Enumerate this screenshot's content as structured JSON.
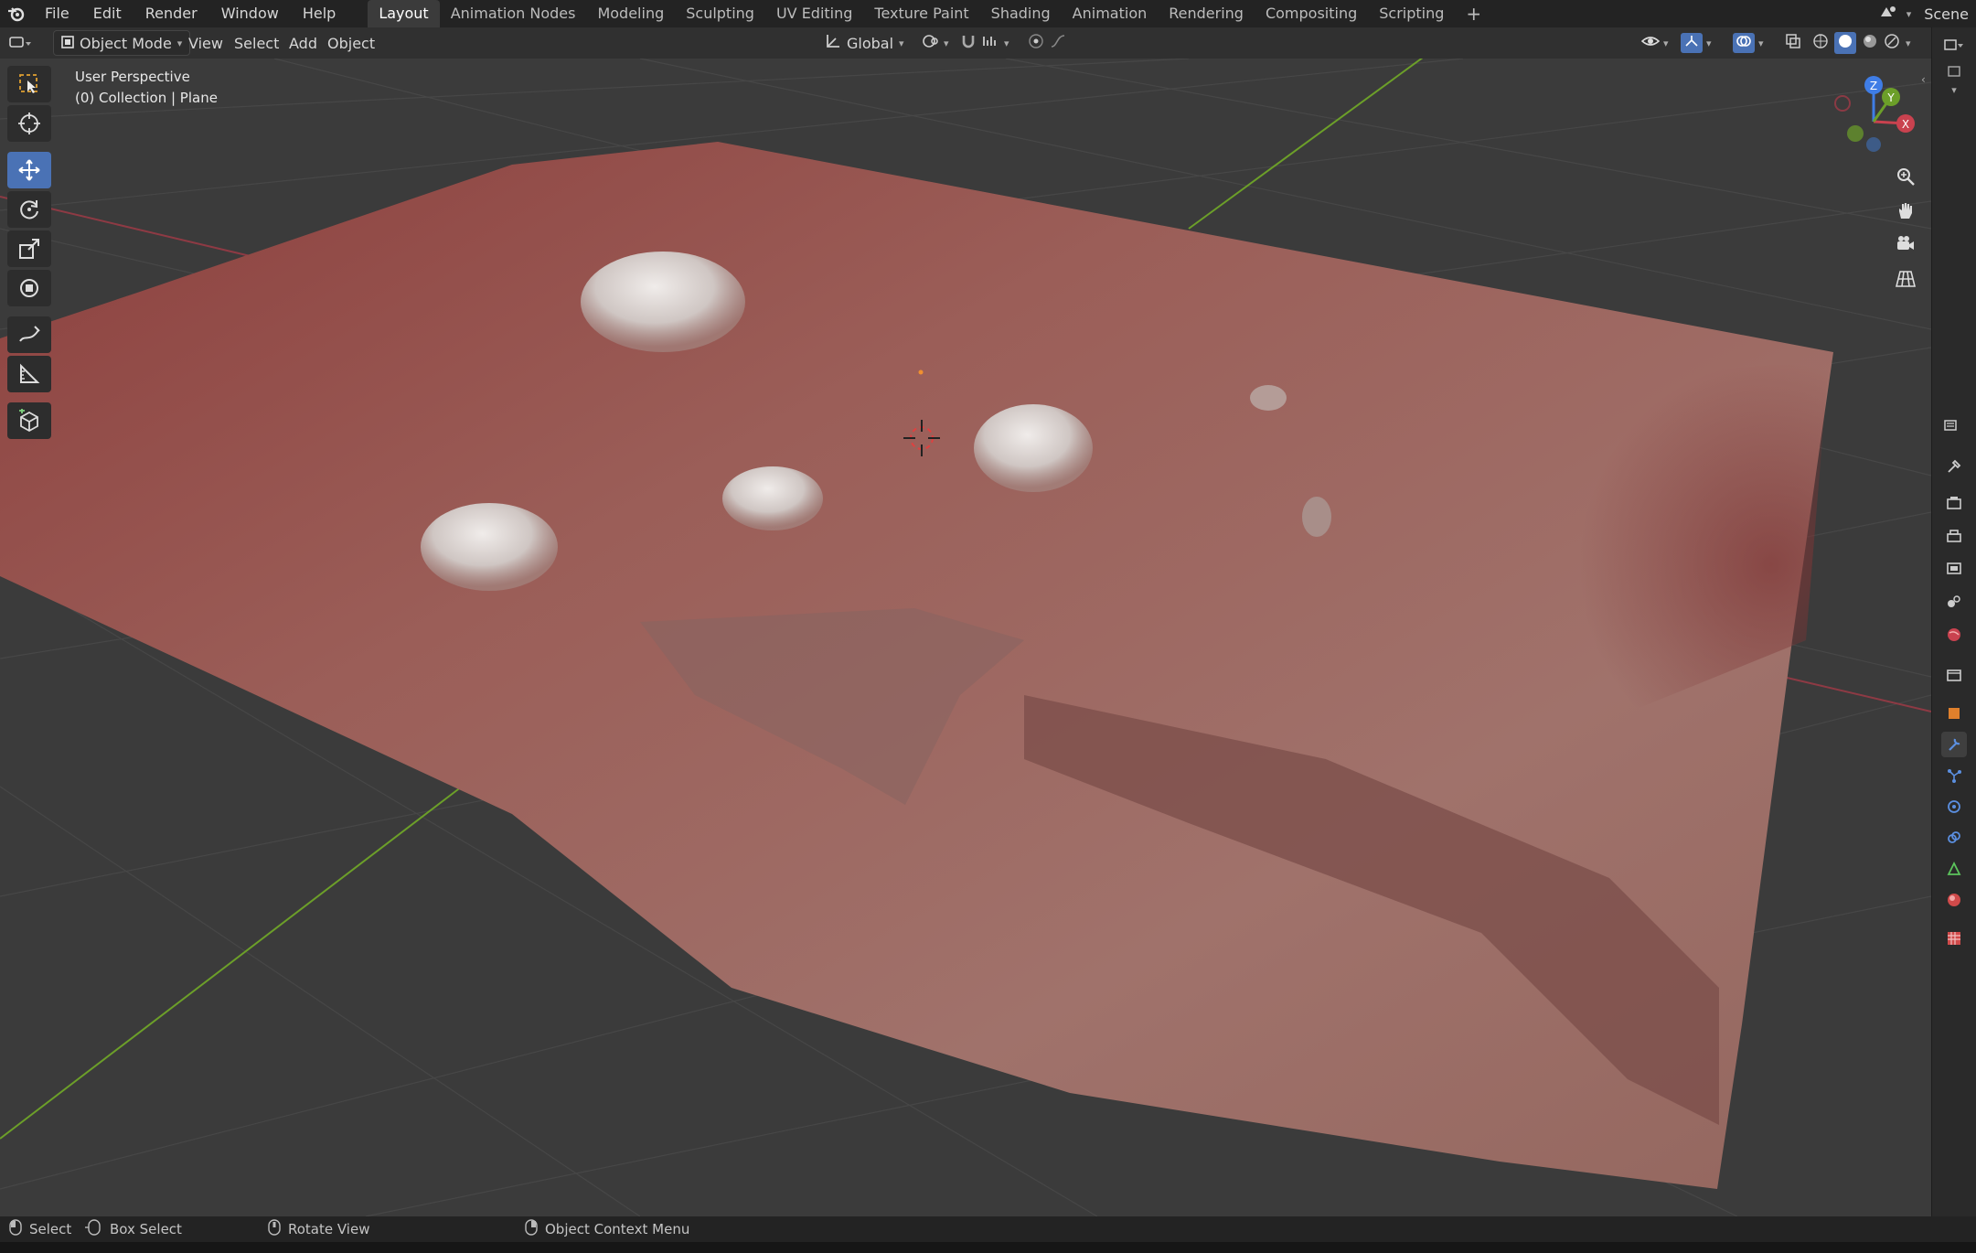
{
  "menu": {
    "items": [
      "File",
      "Edit",
      "Render",
      "Window",
      "Help"
    ]
  },
  "workspaces": {
    "tabs": [
      "Layout",
      "Animation Nodes",
      "Modeling",
      "Sculpting",
      "UV Editing",
      "Texture Paint",
      "Shading",
      "Animation",
      "Rendering",
      "Compositing",
      "Scripting"
    ],
    "active": "Layout"
  },
  "scene": {
    "name": "Scene"
  },
  "viewport_header": {
    "mode": "Object Mode",
    "menus": [
      "View",
      "Select",
      "Add",
      "Object"
    ],
    "transform_orientation": "Global"
  },
  "overlay": {
    "perspective": "User Perspective",
    "collection": "(0) Collection | Plane"
  },
  "gizmo": {
    "x": "X",
    "y": "Y",
    "z": "Z"
  },
  "statusbar": {
    "select": "Select",
    "box_select": "Box Select",
    "rotate_view": "Rotate View",
    "context_menu": "Object Context Menu"
  },
  "colors": {
    "accent": "#4a72b5",
    "axis_x": "#c9424f",
    "axis_y": "#6c9f29",
    "axis_z": "#3f7de6",
    "terrain": "#9a6c66"
  }
}
